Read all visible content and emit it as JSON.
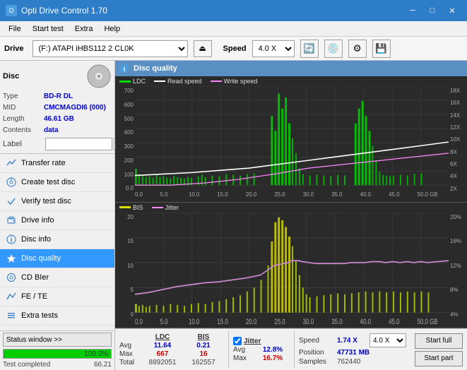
{
  "titleBar": {
    "title": "Opti Drive Control 1.70",
    "minimizeBtn": "─",
    "maximizeBtn": "□",
    "closeBtn": "✕"
  },
  "menuBar": {
    "items": [
      "File",
      "Start test",
      "Extra",
      "Help"
    ]
  },
  "driveBar": {
    "label": "Drive",
    "driveValue": "(F:)  ATAPI iHBS112  2 CL0K",
    "speedLabel": "Speed",
    "speedValue": "4.0 X"
  },
  "disc": {
    "title": "Disc",
    "typeLabel": "Type",
    "typeValue": "BD-R DL",
    "midLabel": "MID",
    "midValue": "CMCMAGDI6 (000)",
    "lengthLabel": "Length",
    "lengthValue": "46.61 GB",
    "contentsLabel": "Contents",
    "contentsValue": "data",
    "labelLabel": "Label",
    "labelValue": ""
  },
  "nav": {
    "items": [
      {
        "id": "transfer-rate",
        "label": "Transfer rate",
        "icon": "📈"
      },
      {
        "id": "create-test-disc",
        "label": "Create test disc",
        "icon": "💿"
      },
      {
        "id": "verify-test-disc",
        "label": "Verify test disc",
        "icon": "✔"
      },
      {
        "id": "drive-info",
        "label": "Drive info",
        "icon": "ℹ"
      },
      {
        "id": "disc-info",
        "label": "Disc info",
        "icon": "📄"
      },
      {
        "id": "disc-quality",
        "label": "Disc quality",
        "icon": "⭐",
        "active": true
      },
      {
        "id": "cd-bier",
        "label": "CD BIer",
        "icon": "🔵"
      },
      {
        "id": "fe-te",
        "label": "FE / TE",
        "icon": "📊"
      },
      {
        "id": "extra-tests",
        "label": "Extra tests",
        "icon": "🔧"
      }
    ]
  },
  "chartHeader": {
    "title": "Disc quality"
  },
  "topChart": {
    "legend": [
      {
        "label": "LDC",
        "color": "#00cc00"
      },
      {
        "label": "Read speed",
        "color": "#ffffff"
      },
      {
        "label": "Write speed",
        "color": "#ff66ff"
      }
    ],
    "yAxisLeft": [
      "700",
      "600",
      "500",
      "400",
      "300",
      "200",
      "100",
      "0.0"
    ],
    "yAxisRight": [
      "18X",
      "16X",
      "14X",
      "12X",
      "10X",
      "8X",
      "6X",
      "4X",
      "2X"
    ],
    "xAxis": [
      "0.0",
      "5.0",
      "10.0",
      "15.0",
      "20.0",
      "25.0",
      "30.0",
      "35.0",
      "40.0",
      "45.0",
      "50.0 GB"
    ]
  },
  "bottomChart": {
    "legend": [
      {
        "label": "BIS",
        "color": "#ffff00"
      },
      {
        "label": "Jitter",
        "color": "#ff66ff"
      }
    ],
    "yAxisLeft": [
      "20",
      "15",
      "10",
      "5",
      "0"
    ],
    "yAxisRight": [
      "20%",
      "16%",
      "12%",
      "8%",
      "4%"
    ],
    "xAxis": [
      "0.0",
      "5.0",
      "10.0",
      "15.0",
      "20.0",
      "25.0",
      "30.0",
      "35.0",
      "40.0",
      "45.0",
      "50.0 GB"
    ]
  },
  "stats": {
    "headers": [
      "LDC",
      "BIS"
    ],
    "avgLabel": "Avg",
    "avgLDC": "11.64",
    "avgBIS": "0.21",
    "maxLabel": "Max",
    "maxLDC": "667",
    "maxBIS": "16",
    "totalLabel": "Total",
    "totalLDC": "8892051",
    "totalBIS": "162557",
    "jitterLabel": "Jitter",
    "jitterAvg": "12.8%",
    "jitterMax": "16.7%",
    "speedLabel": "Speed",
    "speedValue": "1.74 X",
    "speedSelect": "4.0 X",
    "positionLabel": "Position",
    "positionValue": "47731 MB",
    "samplesLabel": "Samples",
    "samplesValue": "762440",
    "startFullBtn": "Start full",
    "startPartBtn": "Start part"
  },
  "statusBar": {
    "statusWindowBtn": "Status window >>",
    "statusText": "Test completed",
    "progressPercent": "100.0%",
    "progressValue": "66.21",
    "progressWidth": 100
  }
}
